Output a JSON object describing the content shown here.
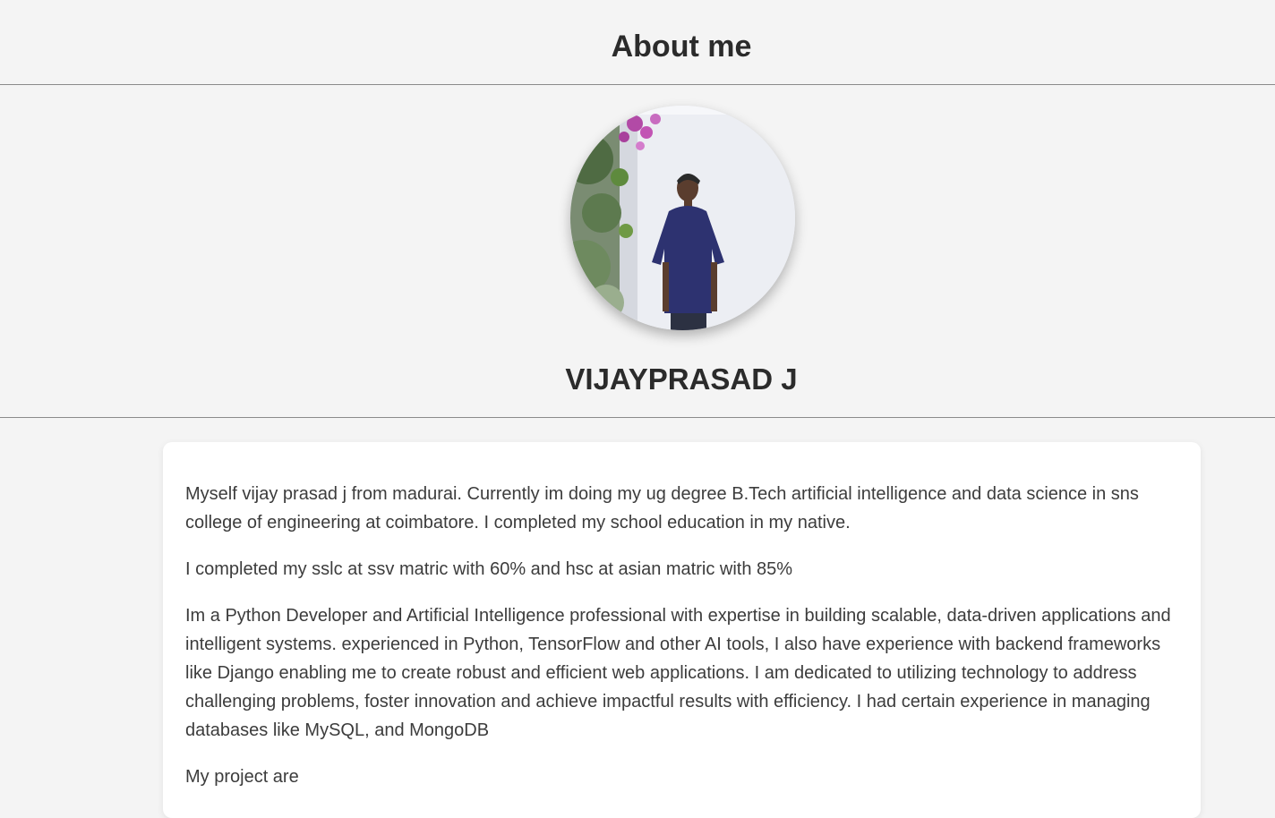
{
  "header": {
    "title": "About me"
  },
  "profile": {
    "photo_icon": "profile-photo",
    "name": "VIJAYPRASAD J"
  },
  "about": {
    "paragraphs": [
      "Myself vijay prasad j from madurai. Currently im doing my ug degree B.Tech artificial intelligence and data science in sns college of engineering at coimbatore. I completed my school education in my native.",
      "I completed my sslc at ssv matric with 60% and hsc at asian matric with 85%",
      "Im a Python Developer and Artificial Intelligence professional with expertise in building scalable, data-driven applications and intelligent systems. experienced in Python, TensorFlow and other AI tools, I also have experience with backend frameworks like Django enabling me to create robust and efficient web applications. I am dedicated to utilizing technology to address challenging problems, foster innovation and achieve impactful results with efficiency. I had certain experience in managing databases like MySQL, and MongoDB",
      "My project are"
    ]
  },
  "colors": {
    "page_background": "#f4f4f4",
    "card_background": "#ffffff",
    "shirt": "#2d3270"
  }
}
